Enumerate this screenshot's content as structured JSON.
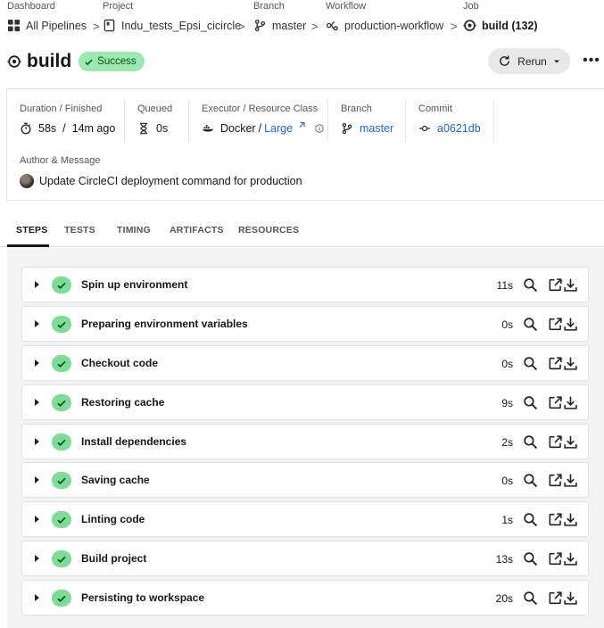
{
  "breadcrumb": {
    "dashboard": {
      "label": "Dashboard",
      "value": "All Pipelines",
      "icon": "dashboard-grid-icon"
    },
    "project": {
      "label": "Project",
      "value": "Indu_tests_Epsi_cicircle",
      "icon": "project-icon"
    },
    "branch": {
      "label": "Branch",
      "value": "master",
      "icon": "branch-icon"
    },
    "workflow": {
      "label": "Workflow",
      "value": "production-workflow",
      "icon": "workflow-icon"
    },
    "job": {
      "label": "Job",
      "value": "build (132)",
      "icon": "job-icon"
    },
    "separator": ">"
  },
  "header": {
    "title": "build",
    "status": "Success",
    "rerun_label": "Rerun",
    "more_label": "•••"
  },
  "info": {
    "duration": {
      "label": "Duration / Finished",
      "duration": "58s",
      "sep": "/",
      "finished": "14m ago"
    },
    "queued": {
      "label": "Queued",
      "value": "0s"
    },
    "executor": {
      "label": "Executor / Resource Class",
      "executor": "Docker",
      "sep": "/",
      "resource_class": "Large"
    },
    "branch": {
      "label": "Branch",
      "value": "master"
    },
    "commit": {
      "label": "Commit",
      "value": "a0621db"
    },
    "author": {
      "label": "Author & Message",
      "message": "Update CircleCI deployment command for production"
    }
  },
  "tabs": [
    {
      "label": "STEPS",
      "active": true
    },
    {
      "label": "TESTS",
      "active": false
    },
    {
      "label": "TIMING",
      "active": false
    },
    {
      "label": "ARTIFACTS",
      "active": false
    },
    {
      "label": "RESOURCES",
      "active": false
    }
  ],
  "steps": [
    {
      "name": "Spin up environment",
      "duration": "11s"
    },
    {
      "name": "Preparing environment variables",
      "duration": "0s"
    },
    {
      "name": "Checkout code",
      "duration": "0s"
    },
    {
      "name": "Restoring cache",
      "duration": "9s"
    },
    {
      "name": "Install dependencies",
      "duration": "2s"
    },
    {
      "name": "Saving cache",
      "duration": "0s"
    },
    {
      "name": "Linting code",
      "duration": "1s"
    },
    {
      "name": "Build project",
      "duration": "13s"
    },
    {
      "name": "Persisting to workspace",
      "duration": "20s"
    }
  ],
  "colors": {
    "success_badge": "#9be8b0",
    "step_check": "#7ddc95",
    "link": "#1f64d8",
    "steps_background": "#f3f3f3"
  }
}
